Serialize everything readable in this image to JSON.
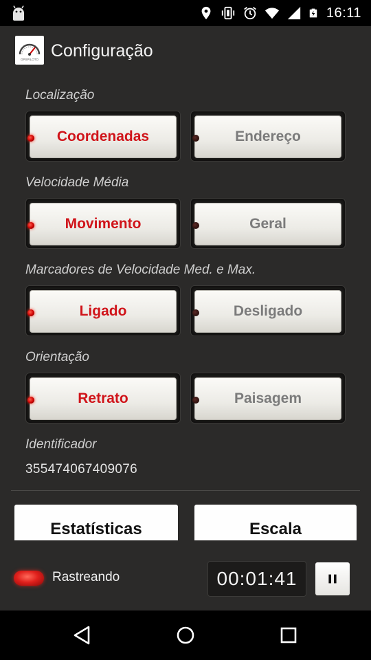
{
  "status_bar": {
    "time": "16:11",
    "icons": [
      "android-debug-icon",
      "location-icon",
      "vibrate-icon",
      "alarm-icon",
      "wifi-icon",
      "signal-icon",
      "battery-charging-icon"
    ]
  },
  "app_bar": {
    "title": "Configuração",
    "logo_text": "GPSPILOTO",
    "logo_icon": "speedometer-icon"
  },
  "settings": {
    "localizacao": {
      "label": "Localização",
      "option_a": "Coordenadas",
      "option_b": "Endereço",
      "selected": "a"
    },
    "velocidade": {
      "label": "Velocidade Média",
      "option_a": "Movimento",
      "option_b": "Geral",
      "selected": "a"
    },
    "marcadores": {
      "label": "Marcadores de Velocidade Med. e Max.",
      "option_a": "Ligado",
      "option_b": "Desligado",
      "selected": "a"
    },
    "orientacao": {
      "label": "Orientação",
      "option_a": "Retrato",
      "option_b": "Paisagem",
      "selected": "a"
    },
    "identificador": {
      "label": "Identificador",
      "value": "355474067409076"
    }
  },
  "actions": {
    "statistics_label": "Estatísticas",
    "scale_label": "Escala"
  },
  "tracking": {
    "status_label": "Rastreando",
    "timer": "00:01:41",
    "pause_icon": "pause-icon"
  },
  "nav_bar": {
    "buttons": [
      "back-icon",
      "home-icon",
      "recents-icon"
    ]
  },
  "colors": {
    "background": "#2b2a29",
    "active_text": "#d0141a",
    "inactive_text": "#7b7b7b",
    "led_on": "#e0201c"
  }
}
